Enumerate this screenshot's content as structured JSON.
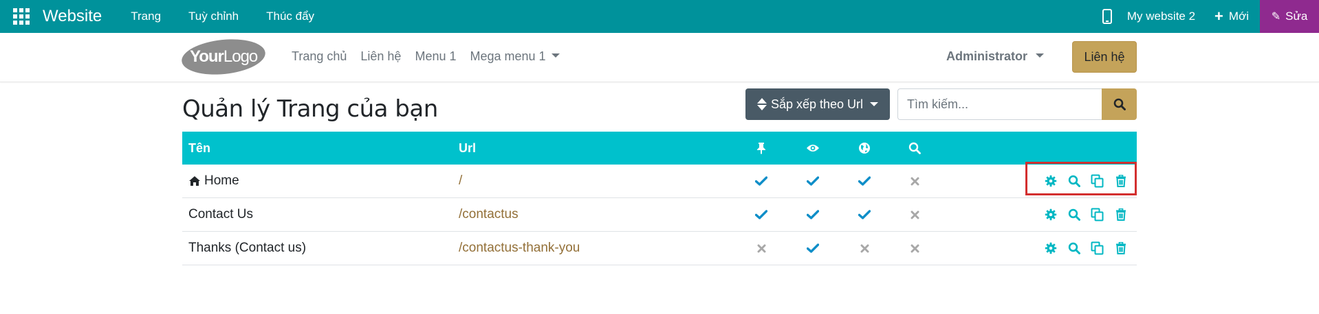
{
  "topbar": {
    "app_title": "Website",
    "menus": [
      "Trang",
      "Tuỳ chỉnh",
      "Thúc đẩy"
    ],
    "website_switch": "My website 2",
    "new_label": "Mới",
    "edit_label": "Sửa",
    "background_color": "#00929b",
    "edit_color": "#8f2a8f"
  },
  "header": {
    "logo": {
      "part1": "Your",
      "part2": "Logo"
    },
    "nav": [
      "Trang chủ",
      "Liên hệ",
      "Menu 1",
      "Mega menu 1"
    ],
    "user": "Administrator",
    "contact_button": "Liên hệ"
  },
  "page": {
    "title": "Quản lý Trang của bạn",
    "sort_label": "Sắp xếp theo Url",
    "search_placeholder": "Tìm kiếm..."
  },
  "table": {
    "columns": {
      "name": "Tên",
      "url": "Url"
    },
    "column_icons": [
      "pin-icon",
      "eye-icon",
      "globe-icon",
      "search-icon"
    ],
    "header_color": "#00c1cc",
    "check_color": "#0f8ec8",
    "cross_color": "#a8a8a8",
    "rows": [
      {
        "name": "Home",
        "url": "/",
        "home_icon": true,
        "flags": [
          true,
          true,
          true,
          false
        ]
      },
      {
        "name": "Contact Us",
        "url": "/contactus",
        "flags": [
          true,
          true,
          true,
          false
        ]
      },
      {
        "name": "Thanks (Contact us)",
        "url": "/contactus-thank-you",
        "flags": [
          false,
          true,
          false,
          false
        ]
      }
    ],
    "row_actions": [
      "gear-icon",
      "search-icon",
      "copy-icon",
      "trash-icon"
    ]
  },
  "highlight_color": "#d32f2f"
}
